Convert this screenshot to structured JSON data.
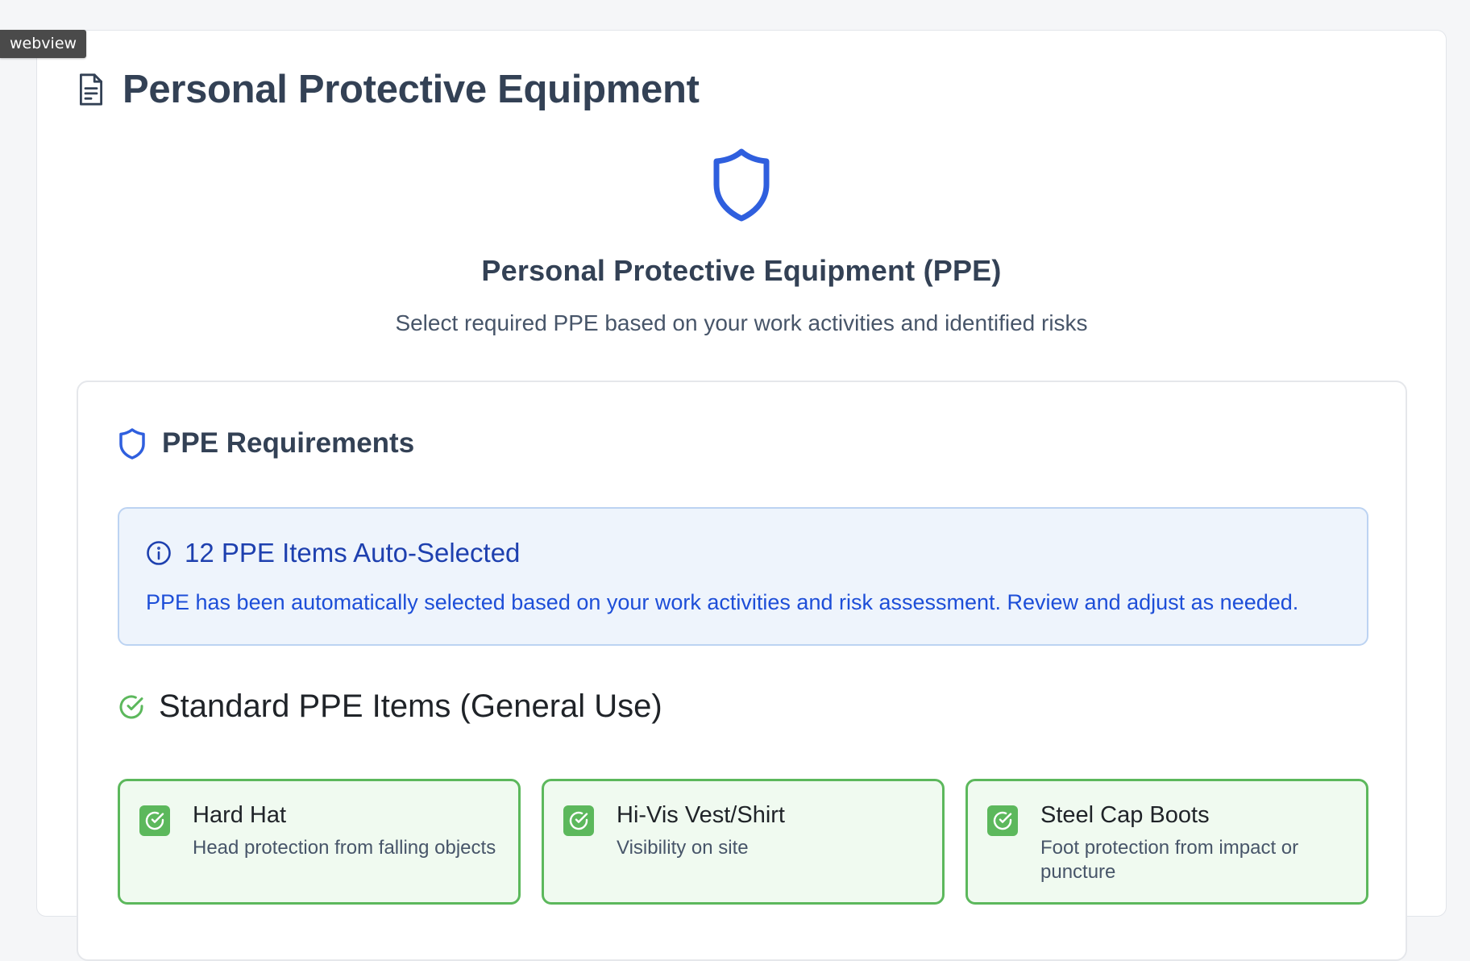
{
  "webview_tag": "webview",
  "page": {
    "title": "Personal Protective Equipment",
    "hero_title": "Personal Protective Equipment (PPE)",
    "hero_subtitle": "Select required PPE based on your work activities and identified risks"
  },
  "requirements": {
    "title": "PPE Requirements",
    "info": {
      "title": "12 PPE Items Auto-Selected",
      "text": "PPE has been automatically selected based on your work activities and risk assessment. Review and adjust as needed."
    },
    "standard": {
      "title": "Standard PPE Items (General Use)",
      "items": [
        {
          "name": "Hard Hat",
          "description": "Head protection from falling objects",
          "checked": true
        },
        {
          "name": "Hi-Vis Vest/Shirt",
          "description": "Visibility on site",
          "checked": true
        },
        {
          "name": "Steel Cap Boots",
          "description": "Foot protection from impact or puncture",
          "checked": true
        }
      ]
    }
  },
  "colors": {
    "accent_blue": "#2f5fde",
    "selected_green": "#5cb85c",
    "info_text": "#1d4ed8"
  },
  "icons": {
    "title_icon": "document-icon",
    "hero_icon": "shield-icon",
    "section_icon": "shield-icon",
    "info_icon": "info-icon",
    "standard_icon": "check-circle-icon",
    "item_check_icon": "checkbox-checked-icon"
  }
}
